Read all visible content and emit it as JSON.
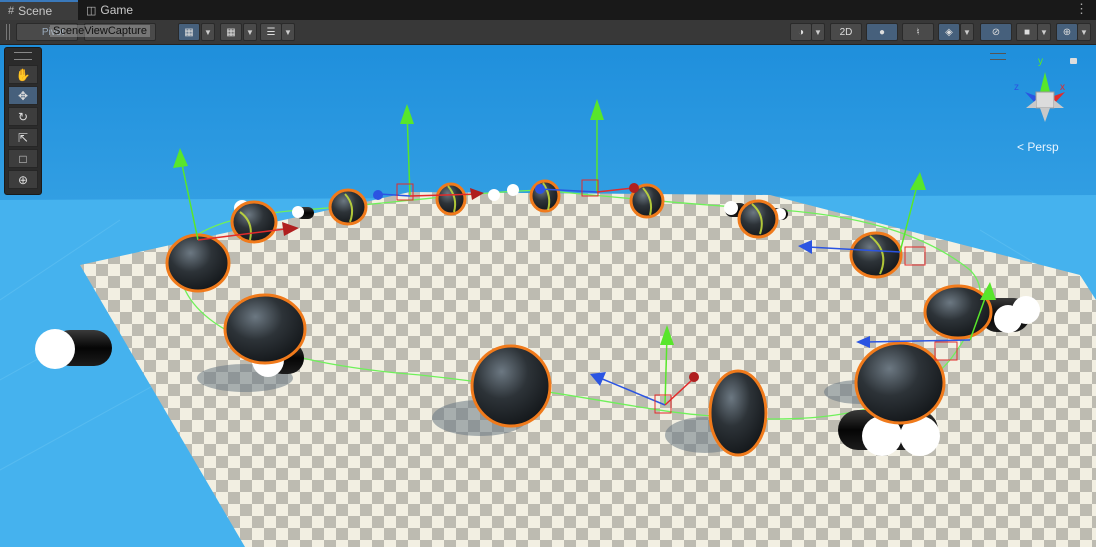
{
  "tabs": [
    {
      "label": "Scene",
      "icon": "grid-icon",
      "active": true
    },
    {
      "label": "Game",
      "icon": "gamepad-icon",
      "active": false
    }
  ],
  "toolbar": {
    "overlay_label": "SceneViewCapture",
    "left_hidden_label": "Pivot",
    "mode_2d": "2D"
  },
  "tools": [
    "hand-tool",
    "move-tool",
    "rotate-tool",
    "scale-tool",
    "rect-tool",
    "transform-tool"
  ],
  "orientation_gizmo": {
    "x": "x",
    "y": "y",
    "z": "z"
  },
  "projection": "Persp",
  "colors": {
    "sky_top": "#1f8fdc",
    "sky_bottom": "#5cc1f2",
    "water": "#45b2ee",
    "selection_outline": "#f07a1b",
    "axis_x": "#e22b2b",
    "axis_y": "#58e62b",
    "axis_z": "#2b54e2",
    "path_line": "#6ff05a"
  }
}
